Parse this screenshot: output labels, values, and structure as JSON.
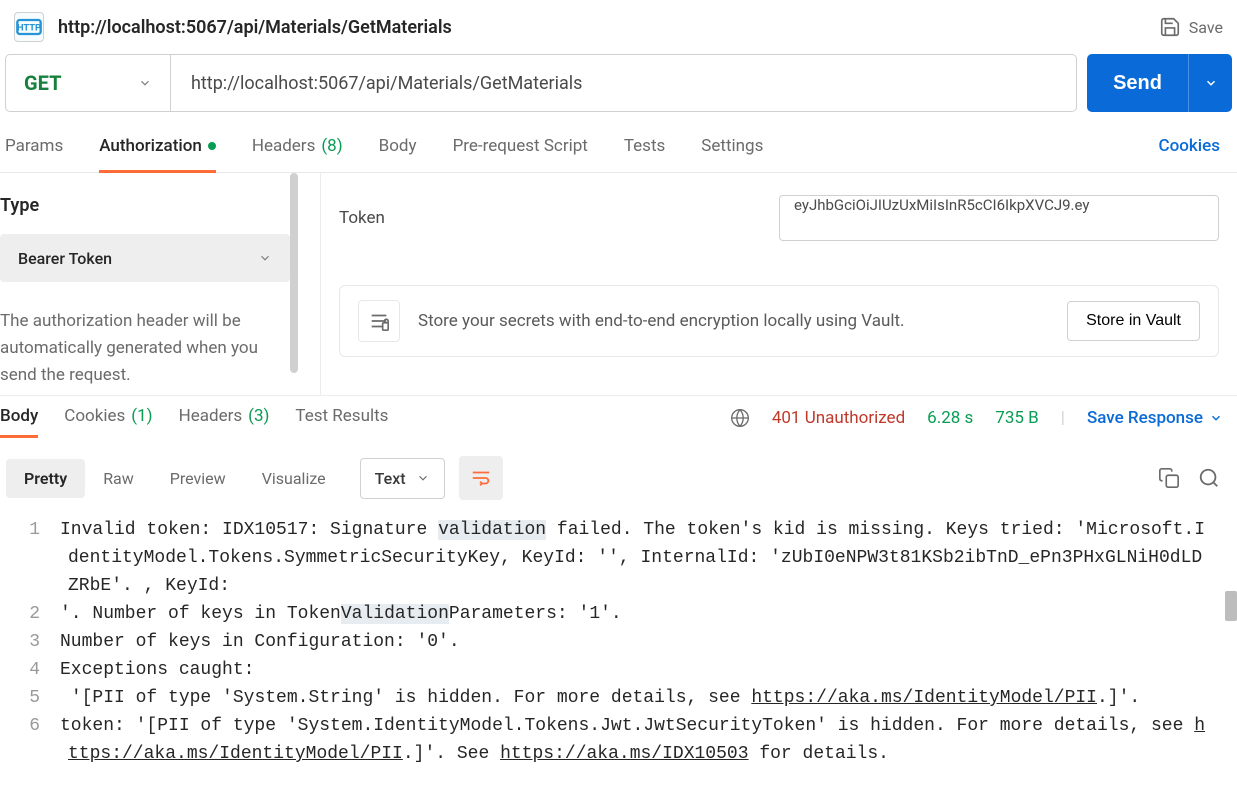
{
  "header": {
    "http_badge": "HTTP",
    "title": "http://localhost:5067/api/Materials/GetMaterials",
    "save": "Save"
  },
  "request": {
    "method": "GET",
    "url": "http://localhost:5067/api/Materials/GetMaterials",
    "send": "Send"
  },
  "tabs": {
    "params": "Params",
    "authorization": "Authorization",
    "headers": "Headers",
    "headers_count": "(8)",
    "body": "Body",
    "prerequest": "Pre-request Script",
    "tests": "Tests",
    "settings": "Settings",
    "cookies": "Cookies"
  },
  "auth": {
    "type_label": "Type",
    "type_value": "Bearer Token",
    "desc": "The authorization header will be automatically generated when you send the request.",
    "token_label": "Token",
    "token_value": "eyJhbGciOiJIUzUxMiIsInR5cCI6IkpXVCJ9.ey",
    "vault_text": "Store your secrets with end-to-end encryption locally using Vault.",
    "vault_btn": "Store in Vault"
  },
  "response": {
    "tabs": {
      "body": "Body",
      "cookies": "Cookies",
      "cookies_count": "(1)",
      "headers": "Headers",
      "headers_count": "(3)",
      "test_results": "Test Results"
    },
    "status": "401 Unauthorized",
    "time": "6.28 s",
    "size": "735 B",
    "save": "Save Response"
  },
  "view": {
    "pretty": "Pretty",
    "raw": "Raw",
    "preview": "Preview",
    "visualize": "Visualize",
    "format": "Text"
  },
  "code": {
    "l1a": "Invalid token: IDX10517: Signature ",
    "l1hl": "validation",
    "l1b": " failed. The token's kid is missing. Keys tried: 'Microsoft.IdentityModel.Tokens.SymmetricSecurityKey, KeyId: '', InternalId: 'zUbI0eNPW3t81KSb2ibTnD_ePn3PHxGLNiH0dLDZRbE'. , KeyId: ",
    "l2a": "'. Number of keys in Token",
    "l2hl": "Validation",
    "l2b": "Parameters: '1'. ",
    "l3": "Number of keys in Configuration: '0'. ",
    "l4": "Exceptions caught:",
    "l5a": " '[PII of type 'System.String' is hidden. For more details, see ",
    "l5link": "https://aka.ms/IdentityModel/PII",
    "l5b": ".]'.",
    "l6a": "token: '[PII of type 'System.IdentityModel.Tokens.Jwt.JwtSecurityToken' is hidden. For more details, see ",
    "l6link1": "https://aka.ms/IdentityModel/PII",
    "l6b": ".]'. See ",
    "l6link2": "https://aka.ms/IDX10503",
    "l6c": " for details."
  }
}
